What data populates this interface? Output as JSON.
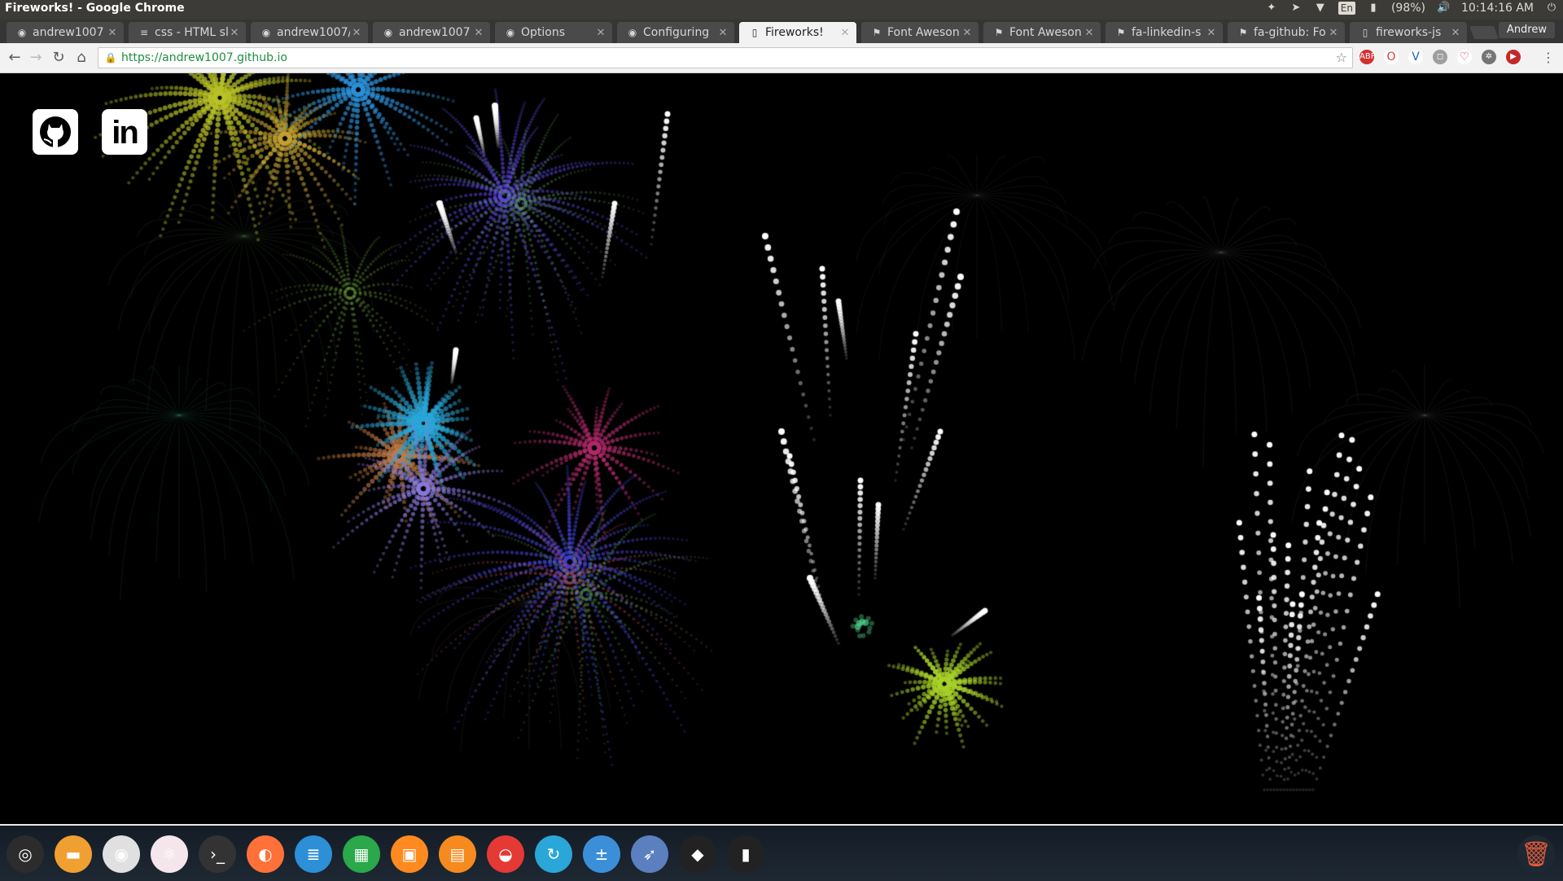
{
  "system": {
    "window_title": "Fireworks! - Google Chrome",
    "tray": {
      "keyboard": "En",
      "battery": "(98%)",
      "clock": "10:14:16 AM"
    }
  },
  "tabs": [
    {
      "title": "andrew1007",
      "icon": "github-icon"
    },
    {
      "title": "css - HTML sl",
      "icon": "stackoverflow-icon"
    },
    {
      "title": "andrew1007/",
      "icon": "github-icon"
    },
    {
      "title": "andrew1007",
      "icon": "github-icon"
    },
    {
      "title": "Options",
      "icon": "github-icon"
    },
    {
      "title": "Configuring",
      "icon": "github-icon"
    },
    {
      "title": "Fireworks!",
      "icon": "page-icon",
      "active": true
    },
    {
      "title": "Font Aweson",
      "icon": "fontawesome-icon"
    },
    {
      "title": "Font Aweson",
      "icon": "fontawesome-icon"
    },
    {
      "title": "fa-linkedin-s",
      "icon": "fontawesome-icon"
    },
    {
      "title": "fa-github: Fo",
      "icon": "fontawesome-icon"
    },
    {
      "title": "fireworks-js",
      "icon": "page-icon"
    }
  ],
  "profile": {
    "name": "Andrew"
  },
  "omnibox": {
    "url": "https://andrew1007.github.io"
  },
  "page": {
    "background": "#000000",
    "links": [
      {
        "icon": "github-icon"
      },
      {
        "icon": "linkedin-icon",
        "text": "in"
      }
    ]
  },
  "dock": {
    "apps": [
      "ubuntu-icon",
      "files-icon",
      "chrome-icon",
      "atom-icon",
      "terminal-icon",
      "firefox-icon",
      "writer-icon",
      "calc-icon",
      "impress-icon",
      "software-center-icon",
      "settings-icon",
      "update-icon",
      "calculator-icon",
      "browser-icon",
      "gimp-icon",
      "usb-icon",
      "trash-icon"
    ]
  }
}
